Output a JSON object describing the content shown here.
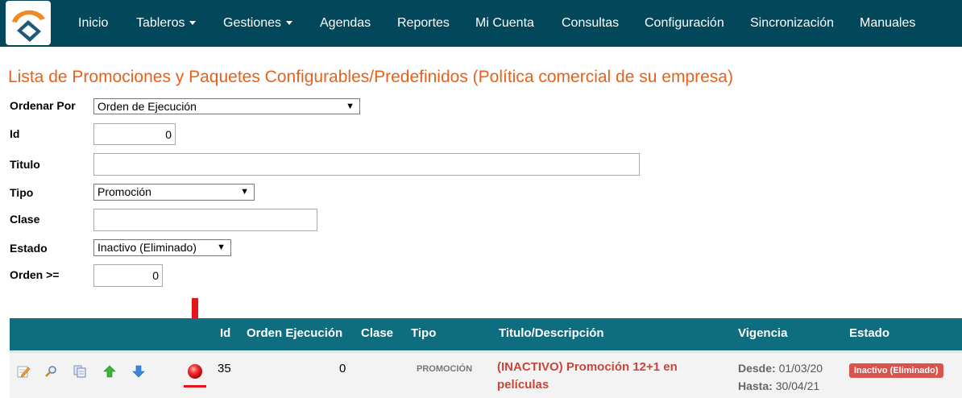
{
  "nav": {
    "items": [
      "Inicio",
      "Tableros",
      "Gestiones",
      "Agendas",
      "Reportes",
      "Mi Cuenta",
      "Consultas",
      "Configuración",
      "Sincronización",
      "Manuales"
    ],
    "dropdown_items": [
      "Tableros",
      "Gestiones"
    ],
    "background_color": "#03475a"
  },
  "page": {
    "title": "Lista de Promociones y Paquetes Configurables/Predefinidos (Política comercial de su empresa)",
    "title_color": "#e8611a"
  },
  "form": {
    "ordenar_por": {
      "label": "Ordenar Por",
      "value": "Orden de Ejecución"
    },
    "id": {
      "label": "Id",
      "value": "0"
    },
    "titulo": {
      "label": "Titulo",
      "value": ""
    },
    "tipo": {
      "label": "Tipo",
      "value": "Promoción"
    },
    "clase": {
      "label": "Clase",
      "value": ""
    },
    "estado": {
      "label": "Estado",
      "value": "Inactivo (Eliminado)"
    },
    "orden": {
      "label": "Orden >=",
      "value": "0"
    }
  },
  "table": {
    "header_color": "#0f6d80",
    "columns": [
      "Id",
      "Orden Ejecución",
      "Clase",
      "Tipo",
      "Titulo/Descripción",
      "Vigencia",
      "Estado"
    ],
    "rows": [
      {
        "actions": [
          "edit-icon",
          "search-icon",
          "copy-icon",
          "arrow-up-icon",
          "arrow-down-icon"
        ],
        "status_dot": "red-dot-icon",
        "id": "35",
        "orden": "0",
        "clase": "",
        "tipo": "PROMOCIÓN",
        "titulo_line1": "(INACTIVO) Promoción 12+1 en",
        "titulo_line2": "películas",
        "desde_label": "Desde:",
        "desde": "01/03/20",
        "hasta_label": "Hasta:",
        "hasta": "30/04/21",
        "estado": "Inactivo (Eliminado)"
      }
    ]
  },
  "annotation": {
    "arrow_color": "#e5151b"
  }
}
